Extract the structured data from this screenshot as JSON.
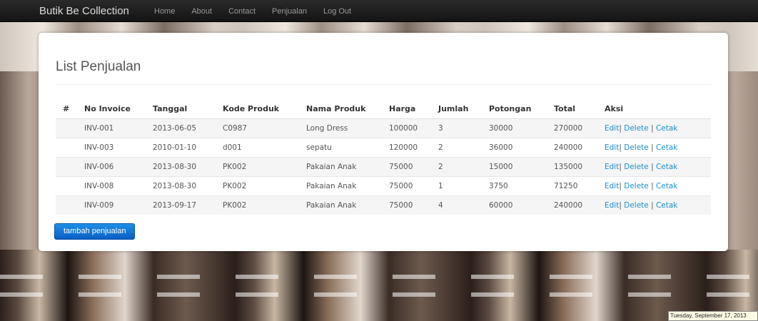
{
  "navbar": {
    "brand": "Butik Be Collection",
    "links": [
      "Home",
      "About",
      "Contact",
      "Penjualan",
      "Log Out"
    ]
  },
  "page": {
    "title": "List Penjualan",
    "button": "tambah penjualan"
  },
  "table": {
    "headers": [
      "#",
      "No Invoice",
      "Tanggal",
      "Kode Produk",
      "Nama Produk",
      "Harga",
      "Jumlah",
      "Potongan",
      "Total",
      "Aksi"
    ],
    "rows": [
      {
        "invoice": "INV-001",
        "tanggal": "2013-06-05",
        "kode": "C0987",
        "nama": "Long Dress",
        "harga": "100000",
        "jumlah": "3",
        "potongan": "30000",
        "total": "270000"
      },
      {
        "invoice": "INV-003",
        "tanggal": "2010-01-10",
        "kode": "d001",
        "nama": "sepatu",
        "harga": "120000",
        "jumlah": "2",
        "potongan": "36000",
        "total": "240000"
      },
      {
        "invoice": "INV-006",
        "tanggal": "2013-08-30",
        "kode": "PK002",
        "nama": "Pakaian Anak",
        "harga": "75000",
        "jumlah": "2",
        "potongan": "15000",
        "total": "135000"
      },
      {
        "invoice": "INV-008",
        "tanggal": "2013-08-30",
        "kode": "PK002",
        "nama": "Pakaian Anak",
        "harga": "75000",
        "jumlah": "1",
        "potongan": "3750",
        "total": "71250"
      },
      {
        "invoice": "INV-009",
        "tanggal": "2013-09-17",
        "kode": "PK002",
        "nama": "Pakaian Anak",
        "harga": "75000",
        "jumlah": "4",
        "potongan": "60000",
        "total": "240000"
      }
    ],
    "actions": {
      "edit": "Edit",
      "delete": "Delete",
      "cetak": "Cetak",
      "separator": "|"
    }
  },
  "clock": "Tuesday, September 17, 2013",
  "colors": {
    "link": "#1a8fd0",
    "button": "#0b6fd4",
    "navbar": "#1c1c1c"
  }
}
